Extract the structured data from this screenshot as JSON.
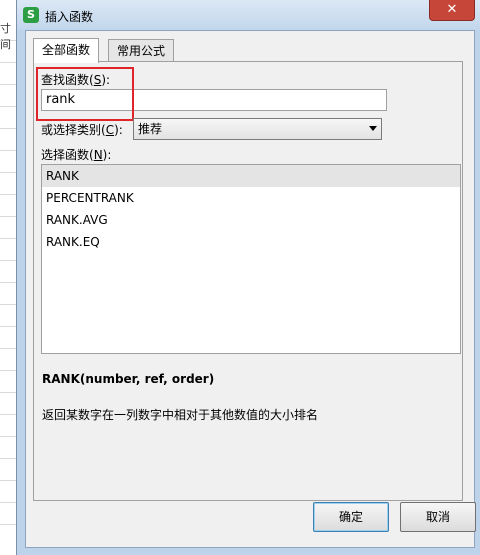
{
  "background": {
    "partial_text": "寸间"
  },
  "window": {
    "title": "插入函数",
    "app_icon_letter": "S",
    "close_symbol": "✕"
  },
  "tabs": [
    {
      "label": "全部函数"
    },
    {
      "label": "常用公式"
    }
  ],
  "search": {
    "label": "查找函数(",
    "hotkey": "S",
    "label_end": "):",
    "value": "rank"
  },
  "category": {
    "label": "或选择类别(",
    "hotkey": "C",
    "label_end": "):",
    "selected": "推荐"
  },
  "function_list": {
    "label": "选择函数(",
    "hotkey": "N",
    "label_end": "):",
    "items": [
      "RANK",
      "PERCENTRANK",
      "RANK.AVG",
      "RANK.EQ"
    ]
  },
  "signature": "RANK(number, ref, order)",
  "description": "返回某数字在一列数字中相对于其他数值的大小排名",
  "buttons": {
    "ok": "确定",
    "cancel": "取消"
  },
  "colors": {
    "highlight": "#e0252a",
    "app_icon": "#2e9e45",
    "close": "#c7463a"
  }
}
